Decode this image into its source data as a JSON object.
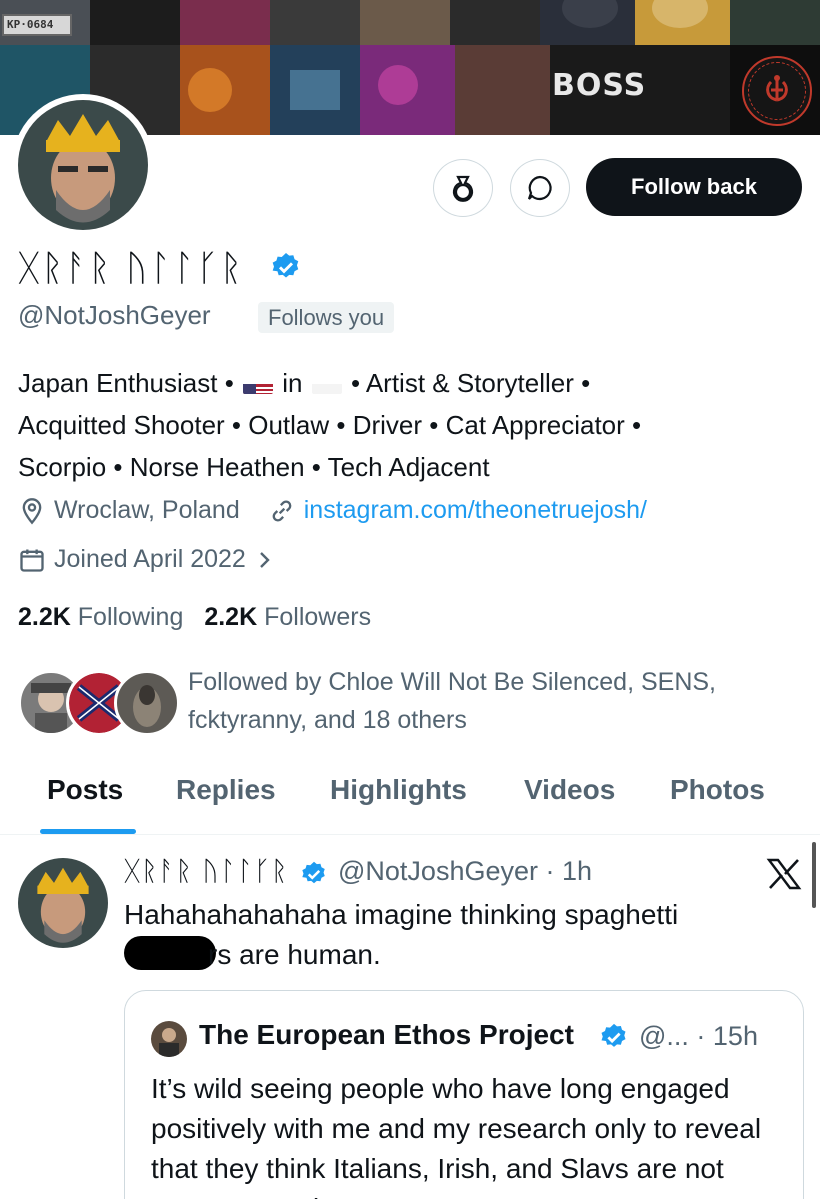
{
  "banner": {
    "plate_text": "KP·0684",
    "boss_text": "BOSS"
  },
  "profile": {
    "display_name": "ᚷᚱᚨᚱ ᚢᛚᛚᚴᚱ",
    "handle": "@NotJoshGeyer",
    "follows_you": "Follows you",
    "bio_parts": {
      "p1": "Japan Enthusiast • ",
      "p2": " in ",
      "p3": " • Artist & Storyteller •",
      "line2": "Acquitted Shooter • Outlaw • Driver • Cat Appreciator •",
      "line3": "Scorpio • Norse Heathen • Tech Adjacent"
    },
    "location": "Wroclaw, Poland",
    "website": "instagram.com/theonetruejosh/",
    "joined": "Joined April 2022",
    "following_count": "2.2K",
    "following_label": "Following",
    "followers_count": "2.2K",
    "followers_label": "Followers",
    "followed_by": "Followed by Chloe Will Not Be Silenced, SENS, fcktyranny, and 18 others"
  },
  "actions": {
    "follow_back": "Follow back"
  },
  "tabs": [
    {
      "label": "Posts",
      "active": true
    },
    {
      "label": "Replies"
    },
    {
      "label": "Highlights"
    },
    {
      "label": "Videos"
    },
    {
      "label": "Photos"
    }
  ],
  "post": {
    "author_name": "ᚷᚱᚨᚱ ᚢᛚᛚᚴᚱ",
    "handle_time": "@NotJoshGeyer · 1h",
    "text_line1": "Hahahahahahaha imagine thinking spaghetti",
    "text_line2_suffix": "rs are human.",
    "quote": {
      "author_name": "The European Ethos Project",
      "handle_time": "@... · 15h",
      "text": "It’s wild seeing people who have long engaged positively with me and my research only to reveal that they think Italians, Irish, and Slavs are not European or human. I am"
    }
  },
  "colors": {
    "accent": "#1d9bf0",
    "text_primary": "#0f1419",
    "text_secondary": "#536471"
  },
  "icons": [
    "location-icon",
    "link-icon",
    "calendar-icon",
    "chevron-right-icon",
    "verified-icon",
    "notification-bag-icon",
    "message-icon",
    "x-logo-icon"
  ]
}
